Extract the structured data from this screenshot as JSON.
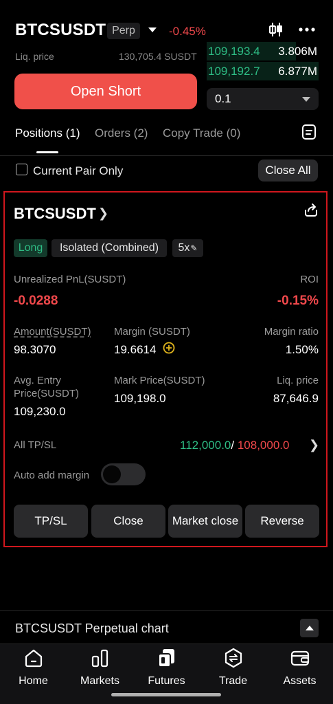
{
  "header": {
    "pair": "BTCSUSDT",
    "contract_type": "Perp",
    "change": "-0.45%"
  },
  "summary": {
    "liq_label": "Liq. price",
    "liq_value": "130,705.4 SUSDT"
  },
  "orderbook": [
    {
      "price": "109,193.4",
      "qty": "3.806M"
    },
    {
      "price": "109,192.7",
      "qty": "6.877M"
    }
  ],
  "trade": {
    "open_short_label": "Open Short",
    "quantity_value": "0.1"
  },
  "tabs": [
    {
      "label": "Positions (1)"
    },
    {
      "label": "Orders (2)"
    },
    {
      "label": "Copy Trade (0)"
    }
  ],
  "filter": {
    "current_pair_label": "Current Pair Only",
    "close_all_label": "Close All"
  },
  "position": {
    "symbol": "BTCSUSDT",
    "side": "Long",
    "margin_mode": "Isolated (Combined)",
    "leverage": "5x",
    "pnl_label": "Unrealized PnL(SUSDT)",
    "pnl_value": "-0.0288",
    "roi_label": "ROI",
    "roi_value": "-0.15%",
    "amount_label": "Amount(SUSDT)",
    "amount_value": "98.3070",
    "margin_label": "Margin (SUSDT)",
    "margin_value": "19.6614",
    "margin_ratio_label": "Margin ratio",
    "margin_ratio_value": "1.50%",
    "entry_label_1": "Avg. Entry",
    "entry_label_2": "Price(SUSDT)",
    "entry_value": "109,230.0",
    "mark_label": "Mark Price(SUSDT)",
    "mark_value": "109,198.0",
    "liq_label": "Liq. price",
    "liq_value": "87,646.9",
    "tpsl_label": "All TP/SL",
    "tp_value": "112,000.0",
    "separator": "/",
    "sl_value": "108,000.0",
    "auto_margin_label": "Auto add margin",
    "auto_margin_on": false,
    "buttons": {
      "tpsl": "TP/SL",
      "close": "Close",
      "market_close": "Market close",
      "reverse": "Reverse"
    }
  },
  "chart_section": {
    "label": "BTCSUSDT Perpetual chart"
  },
  "nav": [
    {
      "label": "Home",
      "icon": "home-icon"
    },
    {
      "label": "Markets",
      "icon": "markets-icon"
    },
    {
      "label": "Futures",
      "icon": "futures-icon"
    },
    {
      "label": "Trade",
      "icon": "trade-icon"
    },
    {
      "label": "Assets",
      "icon": "wallet-icon"
    }
  ],
  "colors": {
    "buy": "#2ebd85",
    "sell": "#f0484b",
    "highlight_border": "#d0171d"
  }
}
